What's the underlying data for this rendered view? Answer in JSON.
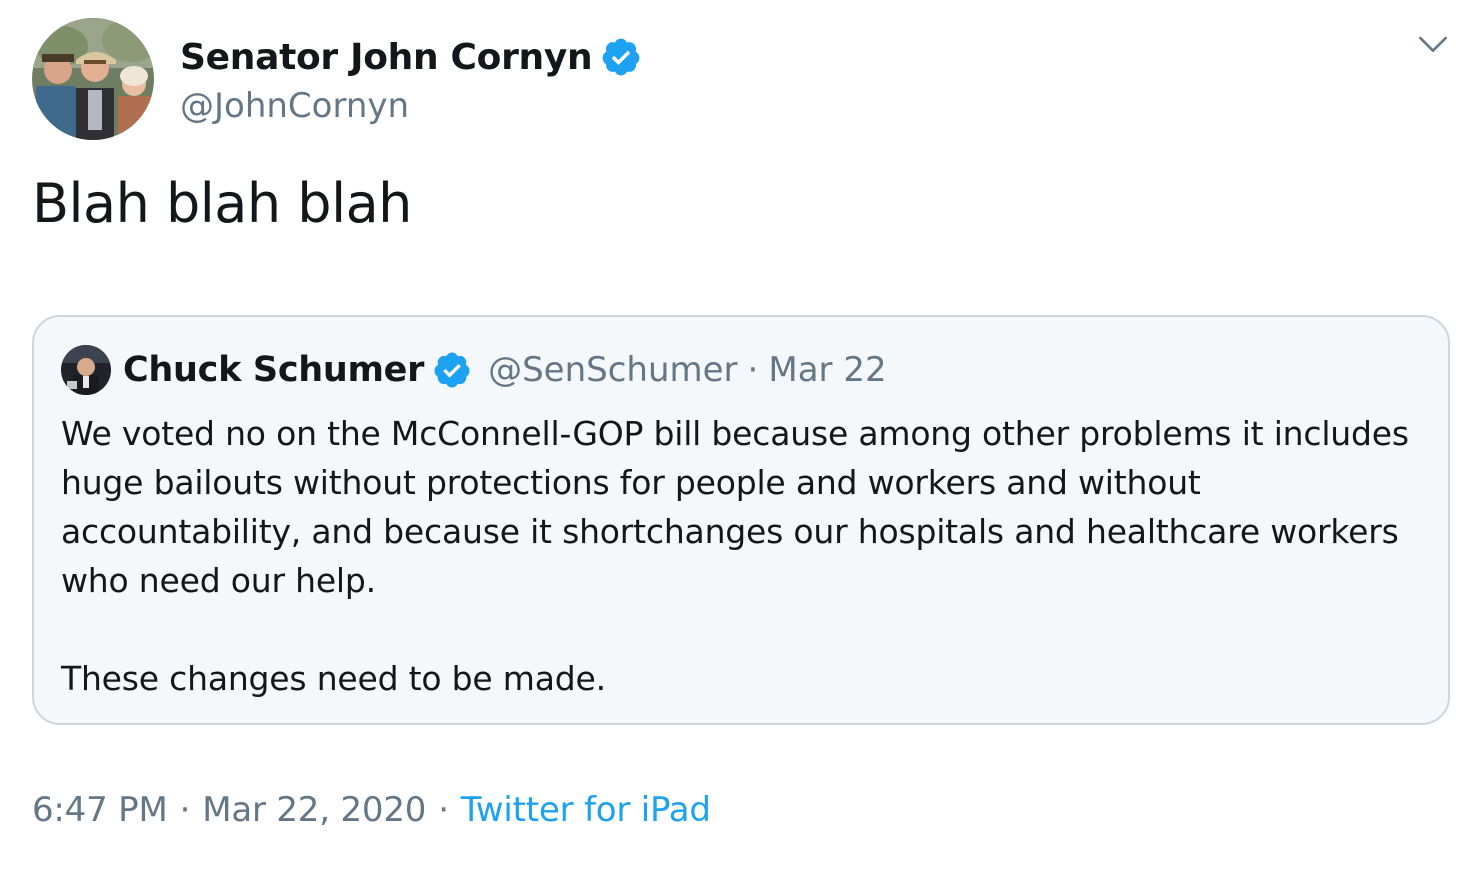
{
  "author": {
    "display_name": "Senator John Cornyn",
    "handle": "@JohnCornyn",
    "verified": true,
    "avatar_icon": "profile-photo"
  },
  "tweet": {
    "text": "Blah blah blah"
  },
  "quoted_tweet": {
    "display_name": "Chuck Schumer",
    "handle": "@SenSchumer",
    "separator": "·",
    "date": "Mar 22",
    "verified": true,
    "paragraphs": [
      "We voted no on the McConnell-GOP bill because among other problems it includes huge bailouts without protections for people and workers and without accountability, and because it shortchanges our hospitals and healthcare workers who need our help.",
      "These changes need to be made."
    ]
  },
  "footer": {
    "time": "6:47 PM",
    "separator": "·",
    "date": "Mar 22, 2020",
    "separator2": "·",
    "source": "Twitter for iPad"
  },
  "colors": {
    "accent": "#1da1f2",
    "text_primary": "#14171a",
    "text_secondary": "#657786",
    "quote_border": "#ccd6dd",
    "quote_background": "#f5f8fa"
  }
}
